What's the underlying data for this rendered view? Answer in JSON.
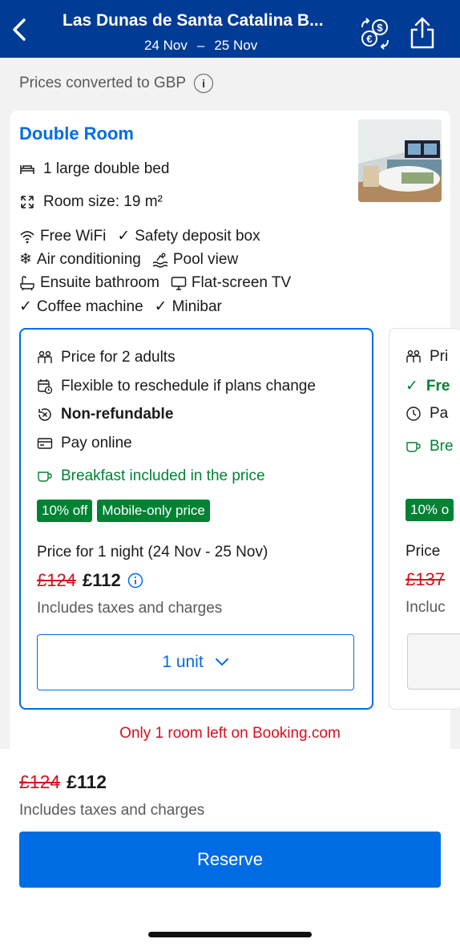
{
  "header": {
    "title": "Las Dunas de Santa Catalina B...",
    "checkin": "24 Nov",
    "dash": "–",
    "checkout": "25 Nov",
    "back_icon": "chevron-left-icon",
    "currency_icon": "currency-exchange-icon",
    "share_icon": "share-icon",
    "bg_color": "#003b95"
  },
  "notice": {
    "text": "Prices converted to GBP",
    "info": "i"
  },
  "room": {
    "title": "Double Room",
    "bed": "1 large double bed",
    "size": "Room size: 19 m²",
    "facilities": [
      [
        "Free WiFi",
        "Safety deposit box"
      ],
      [
        "Air conditioning",
        "Pool view"
      ],
      [
        "Ensuite bathroom",
        "Flat-screen TV"
      ],
      [
        "Coffee machine",
        "Minibar"
      ]
    ]
  },
  "option1": {
    "occupancy": "Price for 2 adults",
    "flexible": "Flexible to reschedule if plans change",
    "refund": "Non-refundable",
    "payment": "Pay online",
    "breakfast": "Breakfast included in the price",
    "badges": [
      "10% off",
      "Mobile-only price"
    ],
    "price_for": "Price for 1 night (24 Nov - 25 Nov)",
    "old_price": "£124",
    "new_price": "£112",
    "taxes": "Includes taxes and charges",
    "units": "1 unit"
  },
  "option2": {
    "occupancy": "Pri",
    "flexible": "Fre",
    "payment": "Pa",
    "breakfast": "Bre",
    "badge": "10% o",
    "price_for": "Price",
    "old_price": "£137",
    "taxes": "Incluc"
  },
  "availability": "Only 1 room left on Booking.com",
  "bottom": {
    "old_price": "£124",
    "new_price": "£112",
    "taxes": "Includes taxes and charges",
    "reserve": "Reserve"
  },
  "colors": {
    "accent": "#006ce4",
    "green": "#008234",
    "red": "#d4111e"
  }
}
